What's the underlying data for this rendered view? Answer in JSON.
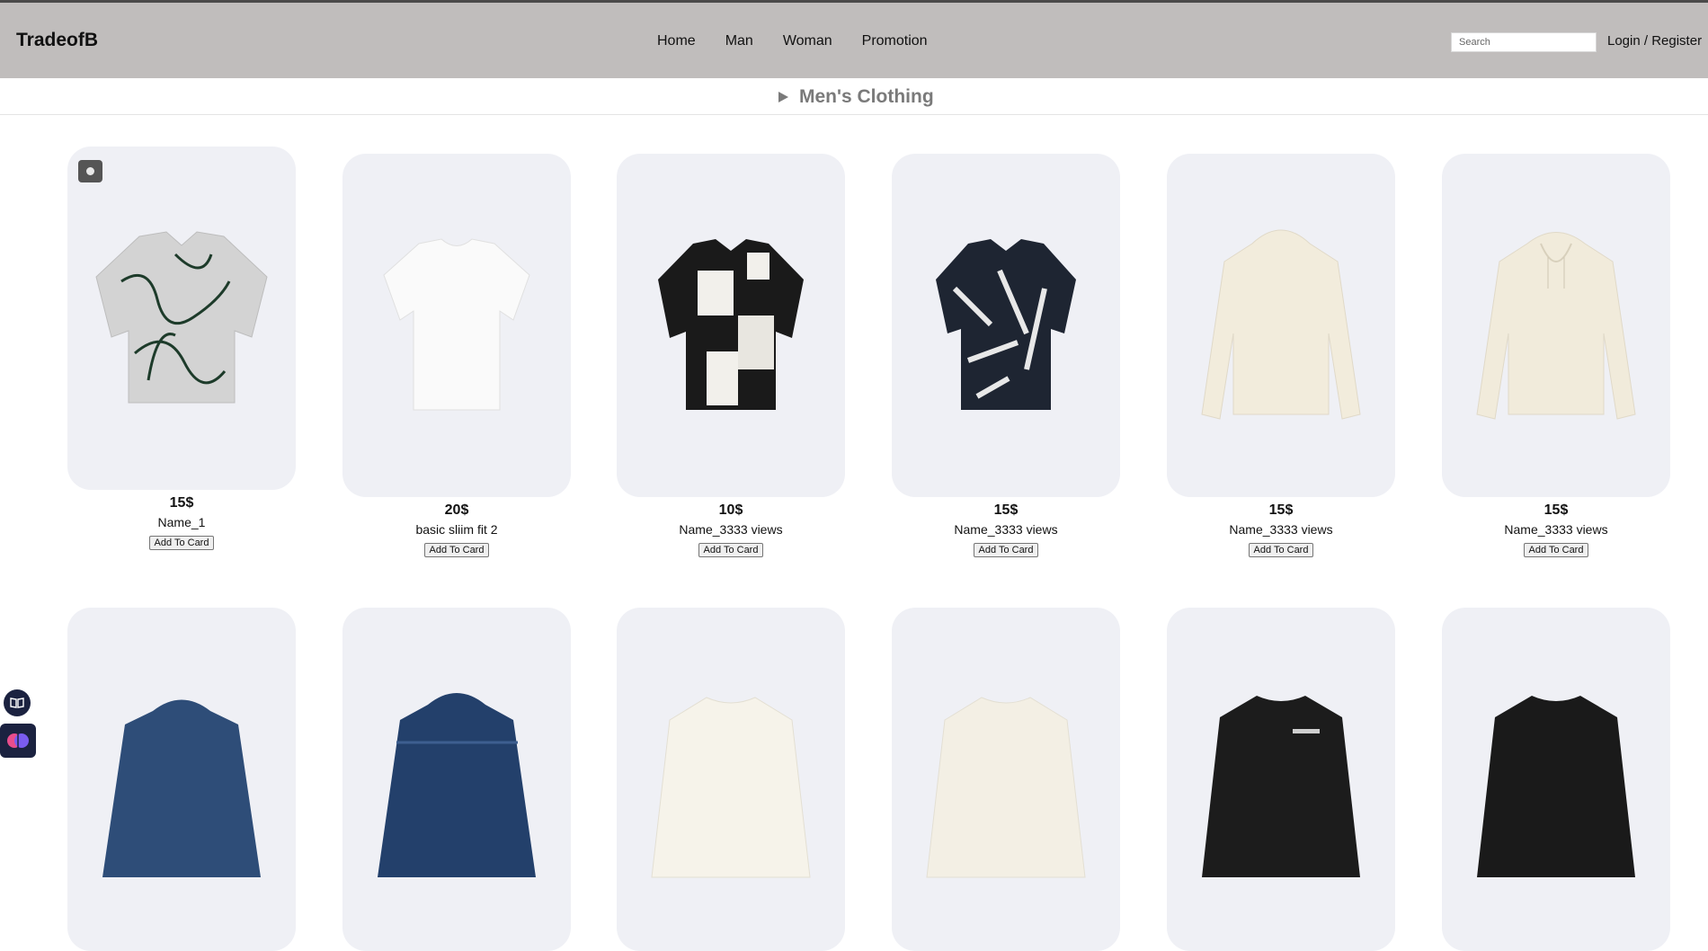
{
  "brand": "TradeofB",
  "nav": [
    "Home",
    "Man",
    "Woman",
    "Promotion"
  ],
  "search_placeholder": "Search",
  "login_label": "Login / Register",
  "section_title": "Men's Clothing",
  "add_label": "Add To Card",
  "products": [
    {
      "price": "15$",
      "name": "Name_1",
      "garment": "shirt-green-pattern"
    },
    {
      "price": "20$",
      "name": "basic sliim fit 2",
      "garment": "tshirt-white"
    },
    {
      "price": "10$",
      "name": "Name_3333 views",
      "garment": "shirt-black-white-block"
    },
    {
      "price": "15$",
      "name": "Name_3333 views",
      "garment": "shirt-navy-leaf"
    },
    {
      "price": "15$",
      "name": "Name_3333 views",
      "garment": "hoodie-cream-back"
    },
    {
      "price": "15$",
      "name": "Name_3333 views",
      "garment": "hoodie-cream-front"
    },
    {
      "price": "",
      "name": "",
      "garment": "hoodie-blue-denim"
    },
    {
      "price": "",
      "name": "",
      "garment": "hoodie-blue-puffer"
    },
    {
      "price": "",
      "name": "",
      "garment": "sweatshirt-white"
    },
    {
      "price": "",
      "name": "",
      "garment": "sweatshirt-cream"
    },
    {
      "price": "",
      "name": "",
      "garment": "sweatshirt-black-print"
    },
    {
      "price": "",
      "name": "",
      "garment": "sweatshirt-black"
    }
  ],
  "floating_buttons": [
    "reader-icon",
    "brain-icon"
  ]
}
